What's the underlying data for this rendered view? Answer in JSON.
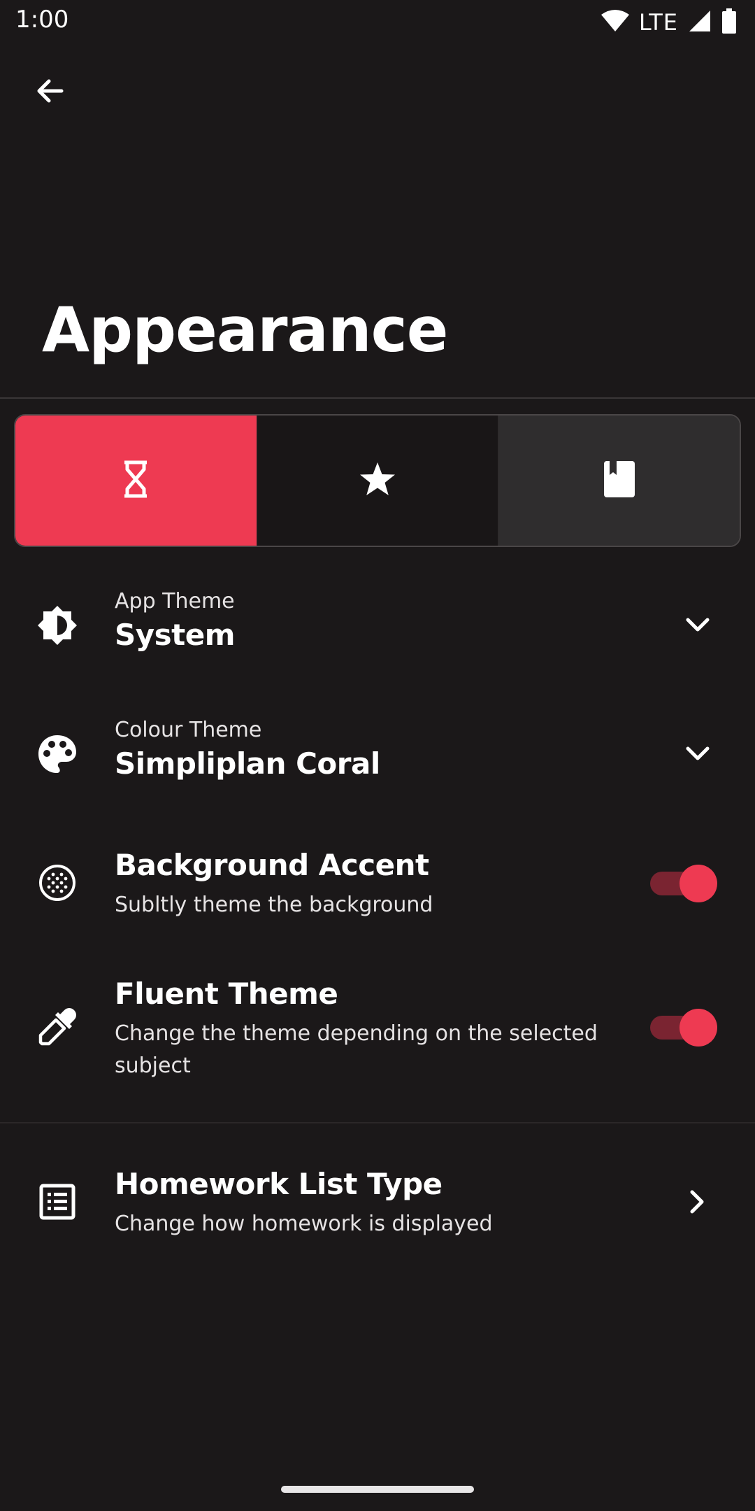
{
  "status_bar": {
    "time": "1:00",
    "network": "LTE"
  },
  "header": {
    "title": "Appearance"
  },
  "segments": [
    {
      "icon": "hourglass-icon",
      "selected": true
    },
    {
      "icon": "star-icon",
      "selected": false
    },
    {
      "icon": "bookmark-book-icon",
      "selected": false
    }
  ],
  "settings": {
    "app_theme": {
      "label": "App Theme",
      "value": "System",
      "icon": "brightness-icon"
    },
    "colour_theme": {
      "label": "Colour Theme",
      "value": "Simpliplan Coral",
      "icon": "palette-icon"
    },
    "background_accent": {
      "title": "Background Accent",
      "subtitle": "Subltly theme the background",
      "enabled": true,
      "icon": "dotted-circle-icon"
    },
    "fluent_theme": {
      "title": "Fluent Theme",
      "subtitle": "Change the theme depending on the selected subject",
      "enabled": true,
      "icon": "eyedropper-icon"
    },
    "homework_list_type": {
      "title": "Homework List Type",
      "subtitle": "Change how homework is displayed",
      "icon": "list-icon"
    }
  },
  "colors": {
    "background": "#1b1819",
    "accent": "#ee3a52",
    "accent_track": "#7a2431",
    "segment_unselected": "#2f2d2e"
  }
}
